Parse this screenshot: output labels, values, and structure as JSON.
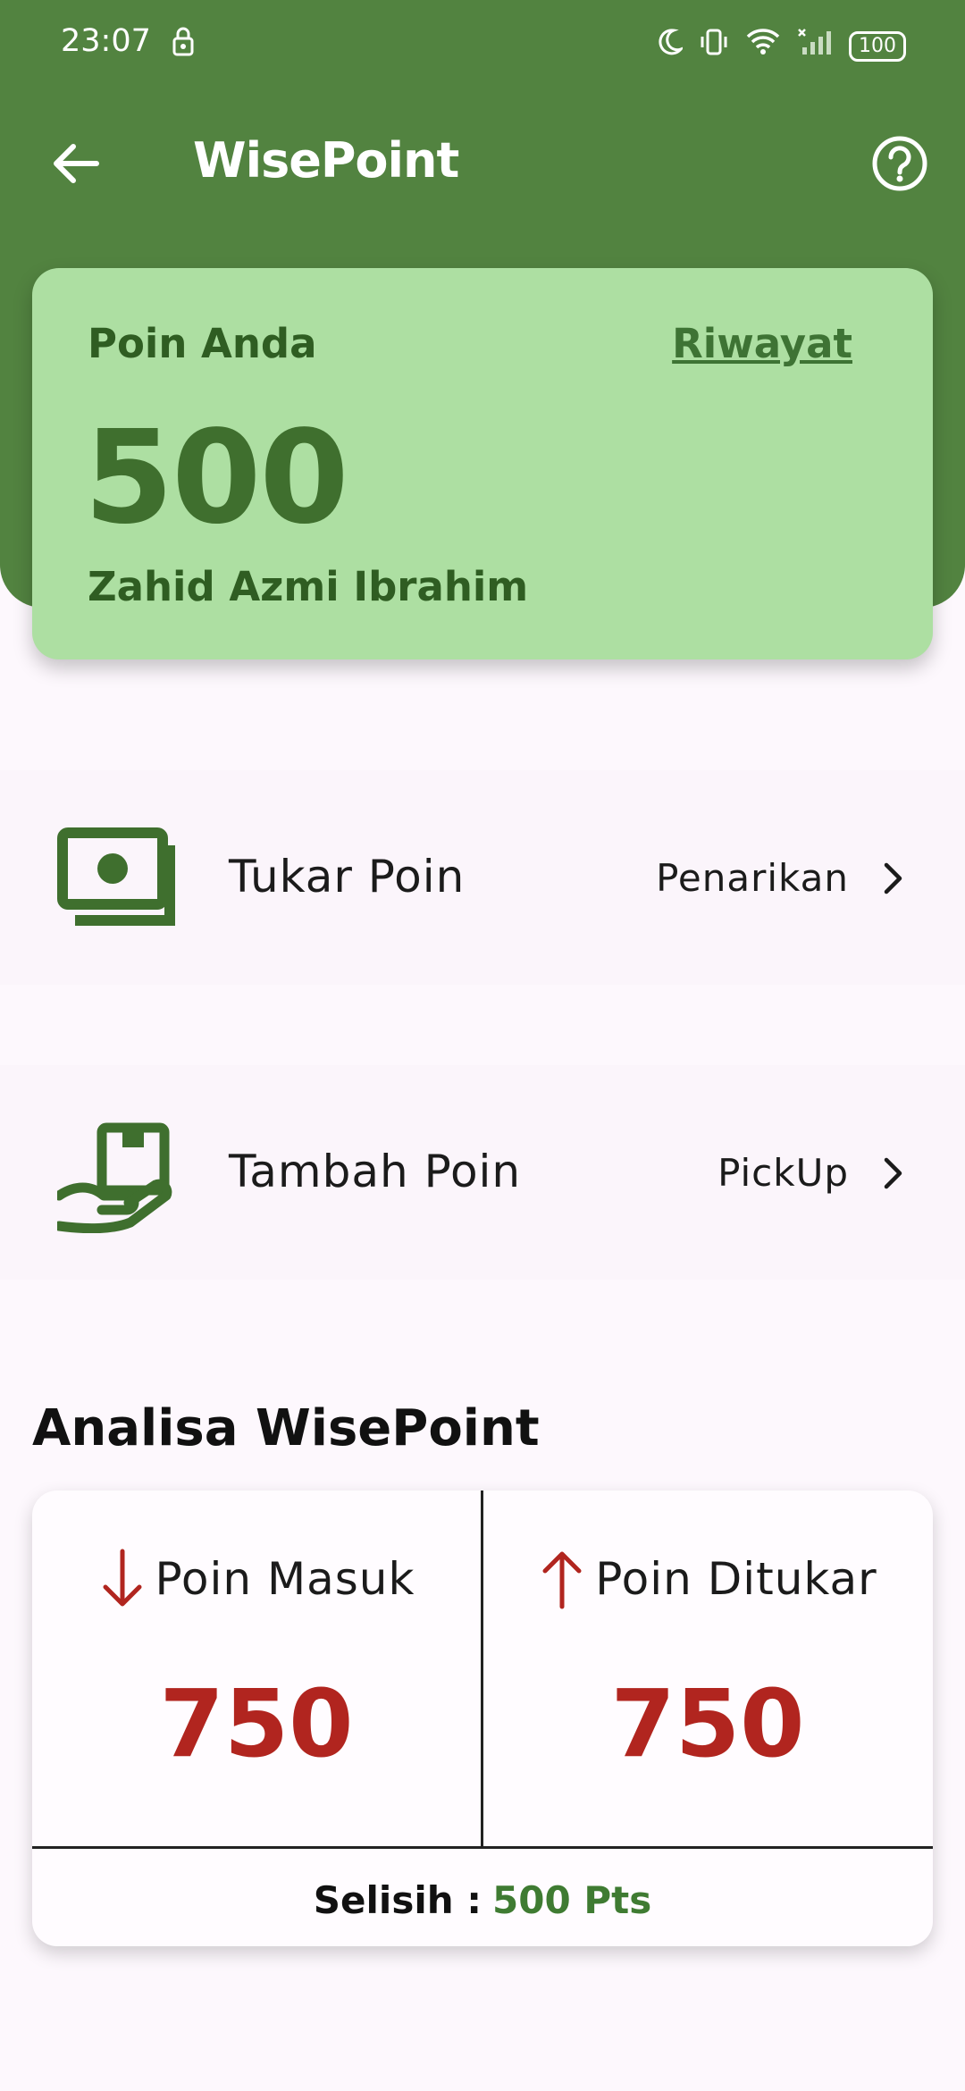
{
  "status": {
    "time": "23:07",
    "battery": "100"
  },
  "app": {
    "title": "WisePoint"
  },
  "points_card": {
    "label": "Poin Anda",
    "history_link": "Riwayat",
    "value": "500",
    "user_name": "Zahid Azmi Ibrahim"
  },
  "menu": [
    {
      "label": "Tukar Poin",
      "action": "Penarikan",
      "icon": "money-stack-icon"
    },
    {
      "label": "Tambah Poin",
      "action": "PickUp",
      "icon": "hand-box-icon"
    }
  ],
  "analysis": {
    "title": "Analisa WisePoint",
    "incoming": {
      "label": "Poin Masuk",
      "value": "750",
      "icon": "arrow-down-icon"
    },
    "redeemed": {
      "label": "Poin Ditukar",
      "value": "750",
      "icon": "arrow-up-icon"
    },
    "difference": {
      "label": "Selisih :",
      "value": "500 Pts"
    }
  },
  "colors": {
    "primary": "#528340",
    "card": "#addfa2",
    "accent_red": "#b1251f",
    "accent_green": "#3f7b32"
  }
}
